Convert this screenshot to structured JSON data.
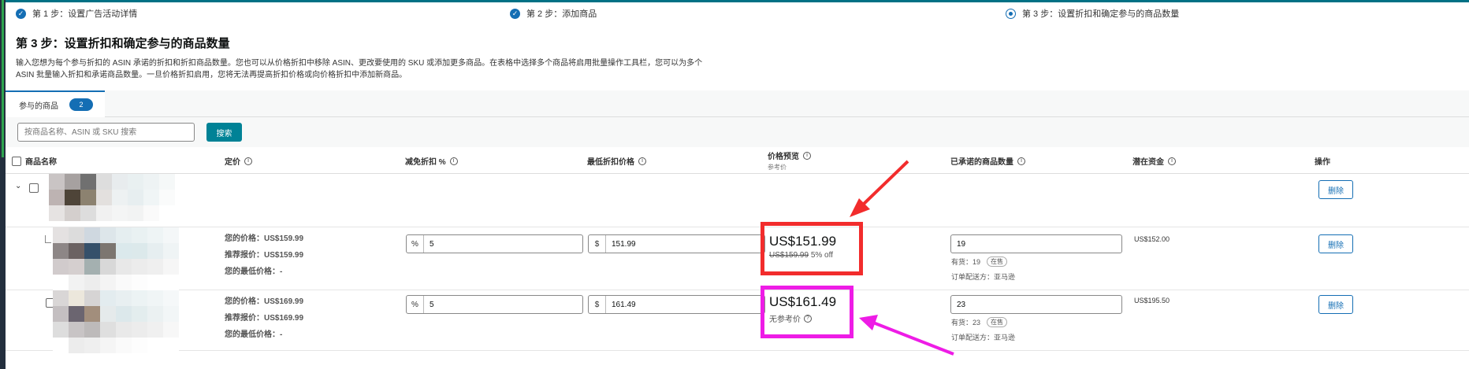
{
  "steps": [
    {
      "label": "第 1 步：设置广告活动详情",
      "state": "done"
    },
    {
      "label": "第 2 步：添加商品",
      "state": "done"
    },
    {
      "label": "第 3 步：设置折扣和确定参与的商品数量",
      "state": "current"
    }
  ],
  "page": {
    "title": "第 3 步：设置折扣和确定参与的商品数量",
    "description_line1": "输入您想为每个参与折扣的 ASIN 承诺的折扣和折扣商品数量。您也可以从价格折扣中移除 ASIN、更改要使用的 SKU 或添加更多商品。在表格中选择多个商品将启用批量操作工具栏，您可以为多个",
    "description_line2": "ASIN 批量输入折扣和承诺商品数量。一旦价格折扣启用，您将无法再提高折扣价格或向价格折扣中添加新商品。"
  },
  "tab": {
    "label": "参与的商品",
    "count": "2"
  },
  "search": {
    "placeholder": "按商品名称、ASIN 或 SKU 搜索",
    "button": "搜索"
  },
  "columns": {
    "name": "商品名称",
    "list_price": "定价",
    "discount": "减免折扣 %",
    "min_price": "最低折扣价格",
    "preview": "价格预览",
    "preview_sub": "参考价",
    "quantity": "已承诺的商品数量",
    "capital": "潜在资金",
    "action": "操作"
  },
  "rows": [
    {
      "your_price": "您的价格：US$159.99",
      "rec_price": "推荐报价：US$159.99",
      "min_price_label": "您的最低价格：-",
      "discount_prefix": "%",
      "discount": "5",
      "min_prefix": "$",
      "min_value": "151.99",
      "preview_price": "US$151.99",
      "preview_ref": "US$159.99",
      "preview_off": "5% off",
      "qty": "19",
      "stock": "有货：19",
      "stock_tag": "在售",
      "fulfill": "订单配送方：亚马逊",
      "capital": "US$152.00",
      "delete": "删除"
    },
    {
      "your_price": "您的价格：US$169.99",
      "rec_price": "推荐报价：US$169.99",
      "min_price_label": "您的最低价格：-",
      "discount_prefix": "%",
      "discount": "5",
      "min_prefix": "$",
      "min_value": "161.49",
      "preview_price": "US$161.49",
      "preview_ref_none": "无参考价",
      "qty": "23",
      "stock": "有货：23",
      "stock_tag": "在售",
      "fulfill": "订单配送方：亚马逊",
      "capital": "US$195.50",
      "delete": "删除"
    }
  ],
  "parent_row": {
    "delete": "删除"
  },
  "colors": {
    "accent": "#146eb4",
    "teal": "#008296",
    "highlight_red": "#f22c2c",
    "highlight_magenta": "#ee1ce6"
  }
}
